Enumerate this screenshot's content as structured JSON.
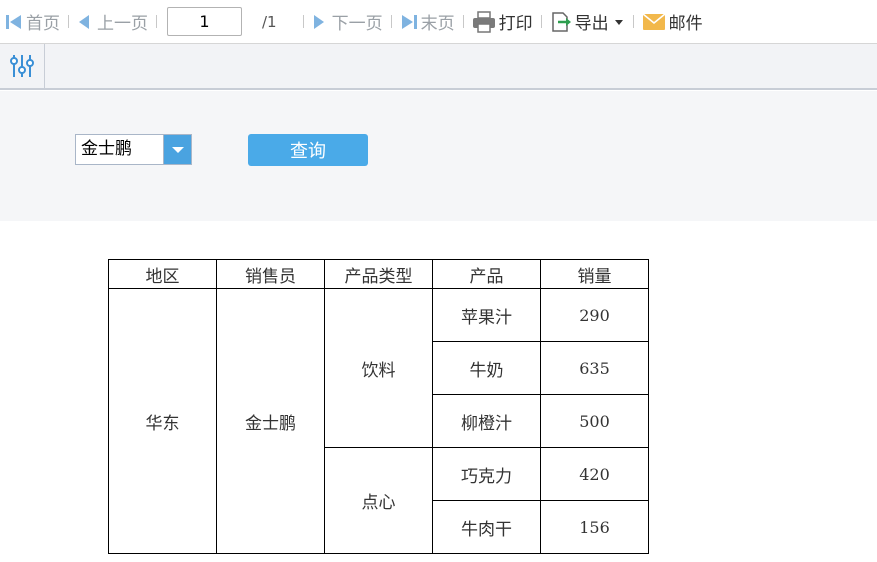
{
  "toolbar": {
    "first_label": "首页",
    "prev_label": "上一页",
    "page_value": "1",
    "page_total": "/1",
    "next_label": "下一页",
    "last_label": "末页",
    "print_label": "打印",
    "export_label": "导出",
    "mail_label": "邮件"
  },
  "params": {
    "salesperson_value": "金士鹏",
    "query_label": "查询"
  },
  "report": {
    "headers": [
      "地区",
      "销售员",
      "产品类型",
      "产品",
      "销量"
    ],
    "region": "华东",
    "salesperson": "金士鹏",
    "groups": [
      {
        "type": "饮料",
        "items": [
          {
            "product": "苹果汁",
            "qty": "290"
          },
          {
            "product": "牛奶",
            "qty": "635"
          },
          {
            "product": "柳橙汁",
            "qty": "500"
          }
        ]
      },
      {
        "type": "点心",
        "items": [
          {
            "product": "巧克力",
            "qty": "420"
          },
          {
            "product": "牛肉干",
            "qty": "156"
          }
        ]
      }
    ]
  },
  "colors": {
    "accent": "#4aaae8",
    "toolbar_bg": "#f2f3f6",
    "panel_bg": "#f5f6f8"
  },
  "icons": [
    "first-page-icon",
    "prev-page-icon",
    "next-page-icon",
    "last-page-icon",
    "printer-icon",
    "export-icon",
    "mail-icon",
    "settings-sliders-icon",
    "dropdown-arrow-icon"
  ]
}
